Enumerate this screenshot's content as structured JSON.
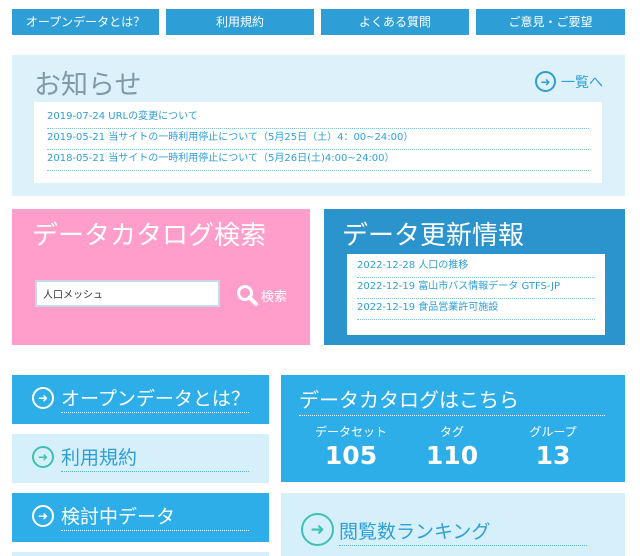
{
  "nav": [
    {
      "label": "オープンデータとは？"
    },
    {
      "label": "利用規約"
    },
    {
      "label": "よくある質問"
    },
    {
      "label": "ご意見・ご要望"
    }
  ],
  "news": {
    "title": "お知らせ",
    "more_label": "一覧へ",
    "items": [
      "2019-07-24 URLの変更について",
      "2019-05-21 当サイトの一時利用停止について（5月25日（土）4：00~24:00）",
      "2018-05-21 当サイトの一時利用停止について（5月26日(土)4:00~24:00）"
    ]
  },
  "search": {
    "title": "データカタログ検索",
    "value": "人口メッシュ",
    "button_label": "検索"
  },
  "updates": {
    "title": "データ更新情報",
    "items": [
      "2022-12-28 人口の推移",
      "2022-12-19 富山市バス情報データ GTFS-JP",
      "2022-12-19 食品営業許可施設"
    ]
  },
  "links": [
    {
      "label": "オープンデータとは？"
    },
    {
      "label": "利用規約"
    },
    {
      "label": "検討中データ"
    }
  ],
  "catalog": {
    "title": "データカタログはこちら",
    "stats": [
      {
        "label": "データセット",
        "value": "105"
      },
      {
        "label": "タグ",
        "value": "110"
      },
      {
        "label": "グループ",
        "value": "13"
      }
    ]
  },
  "ranking": {
    "label": "閲覧数ランキング"
  },
  "icons": {
    "arrow": "arrow-circle-right-icon",
    "search": "magnifier-icon"
  },
  "colors": {
    "accent": "#2e9fd6",
    "pink": "#ff9ecb",
    "light": "#ddf1fa",
    "teal": "#3cc1b3"
  }
}
